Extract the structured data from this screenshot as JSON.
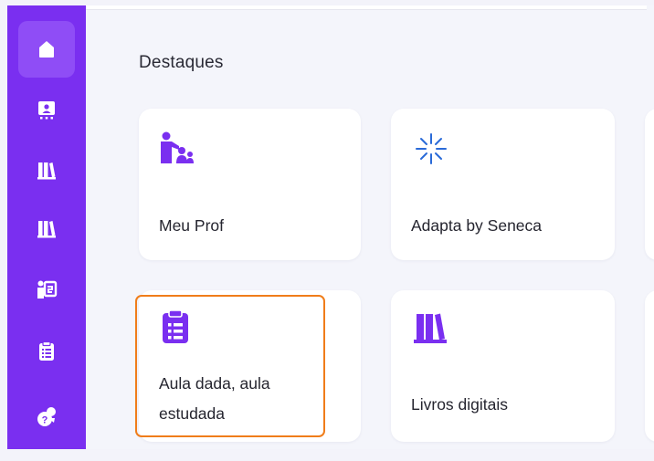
{
  "sidebar": {
    "items": [
      {
        "icon": "home-icon",
        "active": true
      },
      {
        "icon": "teacher-board-icon",
        "active": false
      },
      {
        "icon": "books-icon",
        "active": false
      },
      {
        "icon": "books-icon",
        "active": false
      },
      {
        "icon": "person-board-icon",
        "active": false
      },
      {
        "icon": "clipboard-icon",
        "active": false
      },
      {
        "icon": "support-icon",
        "active": false
      }
    ]
  },
  "main": {
    "section_title": "Destaques",
    "cards": [
      {
        "label": "Meu Prof",
        "icon": "teacher-students-icon"
      },
      {
        "label": "Adapta by Seneca",
        "icon": "sparkle-icon"
      },
      {
        "label_line1": "Aula dada, aula",
        "label_line2": "estudada",
        "icon": "clipboard-list-icon"
      },
      {
        "label": "Livros digitais",
        "icon": "books-icon"
      }
    ]
  },
  "colors": {
    "accent": "#7a2ff0",
    "focus": "#f07d1a",
    "sparkle": "#2a6ad8"
  }
}
